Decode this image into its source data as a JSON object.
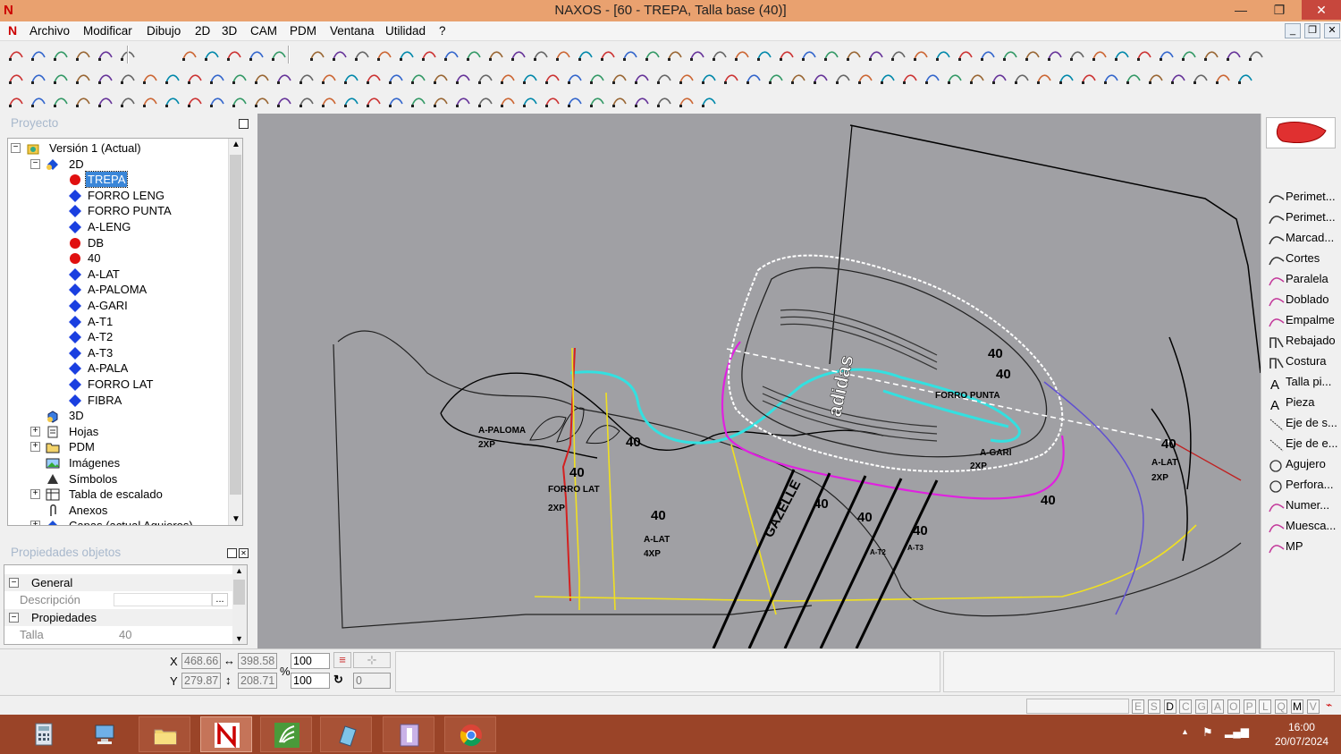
{
  "window": {
    "title": "NAXOS - [60 - TREPA, Talla base (40)]",
    "logo": "N",
    "minimize": "—",
    "restore": "❐",
    "close": "✕"
  },
  "menu": {
    "logo": "N",
    "items": [
      "Archivo",
      "Modificar",
      "Dibujo",
      "2D",
      "3D",
      "CAM",
      "PDM",
      "Ventana",
      "Utilidad",
      "?"
    ],
    "mdi": [
      "_",
      "❐",
      "✕"
    ]
  },
  "project": {
    "header": "Proyecto",
    "tree": [
      {
        "label": "Versión 1 (Actual)",
        "icon": "project-icon",
        "expander": "⊟",
        "level": 0
      },
      {
        "label": "2D",
        "icon": "layers-icon",
        "expander": "⊟",
        "level": 1
      },
      {
        "label": "TREPA",
        "icon": "red-dot-icon",
        "level": 2,
        "selected": true
      },
      {
        "label": "FORRO LENG",
        "icon": "blue-diamond-icon",
        "level": 2
      },
      {
        "label": "FORRO PUNTA",
        "icon": "blue-diamond-icon",
        "level": 2
      },
      {
        "label": "A-LENG",
        "icon": "blue-diamond-icon",
        "level": 2
      },
      {
        "label": "DB",
        "icon": "red-dot-icon",
        "level": 2
      },
      {
        "label": "40",
        "icon": "red-dot-icon",
        "level": 2
      },
      {
        "label": "A-LAT",
        "icon": "blue-diamond-icon",
        "level": 2
      },
      {
        "label": "A-PALOMA",
        "icon": "blue-diamond-icon",
        "level": 2
      },
      {
        "label": "A-GARI",
        "icon": "blue-diamond-icon",
        "level": 2
      },
      {
        "label": "A-T1",
        "icon": "blue-diamond-icon",
        "level": 2
      },
      {
        "label": "A-T2",
        "icon": "blue-diamond-icon",
        "level": 2
      },
      {
        "label": "A-T3",
        "icon": "blue-diamond-icon",
        "level": 2
      },
      {
        "label": "A-PALA",
        "icon": "blue-diamond-icon",
        "level": 2
      },
      {
        "label": "FORRO LAT",
        "icon": "blue-diamond-icon",
        "level": 2
      },
      {
        "label": "FIBRA",
        "icon": "blue-diamond-icon",
        "level": 2
      },
      {
        "label": "3D",
        "icon": "cube-icon",
        "level": 1
      },
      {
        "label": "Hojas",
        "icon": "sheets-icon",
        "expander": "⊞",
        "level": 1
      },
      {
        "label": "PDM",
        "icon": "folder-icon",
        "expander": "⊞",
        "level": 1
      },
      {
        "label": "Imágenes",
        "icon": "image-icon",
        "level": 1
      },
      {
        "label": "Símbolos",
        "icon": "symbol-icon",
        "level": 1
      },
      {
        "label": "Tabla de escalado",
        "icon": "table-icon",
        "expander": "⊞",
        "level": 1
      },
      {
        "label": "Anexos",
        "icon": "paperclip-icon",
        "level": 1
      },
      {
        "label": "Capas (actual Agujeros)",
        "icon": "layers-icon",
        "expander": "⊞",
        "level": 1
      }
    ]
  },
  "properties": {
    "header": "Propiedades objetos",
    "general": "General",
    "descripcion_label": "Descripción",
    "ellipsis": "...",
    "propiedades": "Propiedades",
    "talla_label": "Talla",
    "talla_value": "40"
  },
  "canvas": {
    "labels": {
      "size": "40",
      "a_paloma": "A-PALOMA",
      "a_lat": "A-LAT",
      "a_gari": "A-GARI",
      "forro_punta": "FORRO PUNTA",
      "x2": "2XP",
      "x4": "4XP",
      "gazelle": "GAZELLE",
      "adidas": "adidas",
      "a_t2": "A-T2",
      "a_t3": "A-T3",
      "forro_lat": "FORRO LAT"
    }
  },
  "tools": [
    {
      "label": "Perimet...",
      "icon": "perimeter-curve-icon"
    },
    {
      "label": "Perimet...",
      "icon": "perimeter-curve-icon"
    },
    {
      "label": "Marcad...",
      "icon": "marker-curve-icon"
    },
    {
      "label": "Cortes",
      "icon": "cut-curve-icon"
    },
    {
      "label": "Paralela",
      "icon": "parallel-curve-icon"
    },
    {
      "label": "Doblado",
      "icon": "fold-curve-icon"
    },
    {
      "label": "Empalme",
      "icon": "join-curve-icon"
    },
    {
      "label": "Rebajado",
      "icon": "skive-icon"
    },
    {
      "label": "Costura",
      "icon": "stitch-icon"
    },
    {
      "label": "Talla pi...",
      "icon": "text-a-icon"
    },
    {
      "label": "Pieza",
      "icon": "text-a-icon"
    },
    {
      "label": "Eje de s...",
      "icon": "axis-line-icon"
    },
    {
      "label": "Eje de e...",
      "icon": "axis-line-icon"
    },
    {
      "label": "Agujero",
      "icon": "circle-icon"
    },
    {
      "label": "Perfora...",
      "icon": "circle-icon"
    },
    {
      "label": "Numer...",
      "icon": "number-curve-icon"
    },
    {
      "label": "Muesca...",
      "icon": "notch-curve-icon"
    },
    {
      "label": "MP",
      "icon": "mp-curve-icon"
    }
  ],
  "coords": {
    "x_label": "X",
    "y_label": "Y",
    "x": "468.66",
    "y": "279.87",
    "w": "398.58",
    "h": "208.71",
    "pct_label": "%",
    "sx": "100",
    "sy": "100",
    "rot": "0"
  },
  "status": {
    "letters": [
      "E",
      "S",
      "D",
      "C",
      "G",
      "A",
      "O",
      "P",
      "L",
      "Q",
      "M",
      "V"
    ]
  },
  "taskbar": {
    "time": "16:00",
    "date": "20/07/2024"
  }
}
